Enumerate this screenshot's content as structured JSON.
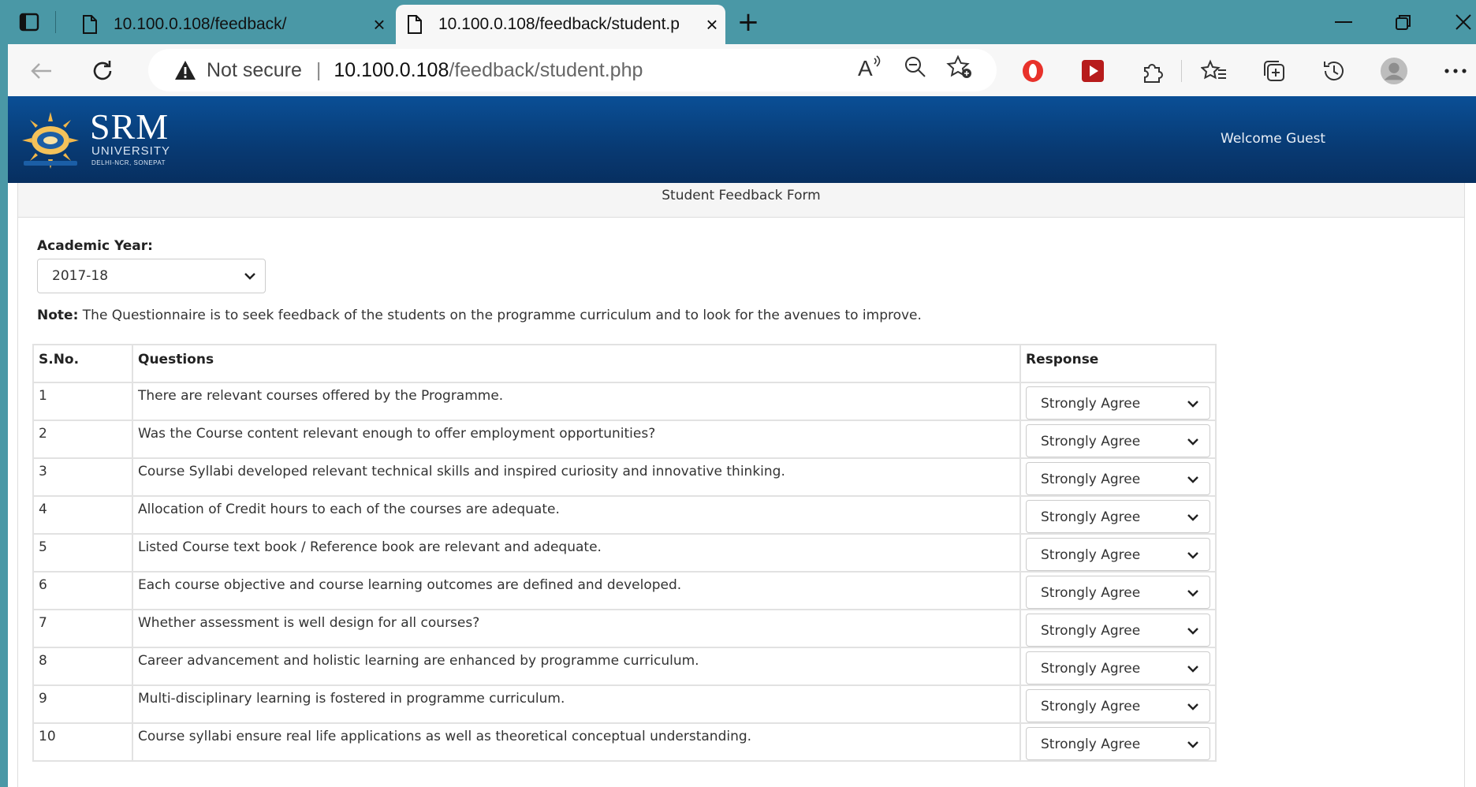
{
  "browser": {
    "tabs": [
      {
        "title": "10.100.0.108/feedback/",
        "active": false
      },
      {
        "title": "10.100.0.108/feedback/student.p",
        "active": true
      }
    ],
    "address": {
      "security_label": "Not secure",
      "host": "10.100.0.108",
      "path": "/feedback/student.php"
    },
    "icons": {
      "tab_actions": "tab-actions-icon",
      "new_tab": "plus-icon",
      "back": "back-arrow-icon",
      "refresh": "refresh-icon",
      "read_aloud": "read-aloud-icon",
      "zoom": "zoom-out-icon",
      "favorite": "add-favorite-icon",
      "opera": "opera-icon",
      "youtube": "youtube-icon",
      "extensions": "extensions-icon",
      "favorites": "favorites-icon",
      "collections": "collections-icon",
      "history": "history-icon",
      "profile": "profile-icon",
      "menu": "more-icon"
    }
  },
  "site": {
    "logo": {
      "name": "SRM",
      "line1": "UNIVERSITY",
      "line2": "DELHI-NCR, SONEPAT"
    },
    "welcome": "Welcome Guest"
  },
  "form": {
    "title": "Student Feedback Form",
    "academic_year_label": "Academic Year:",
    "academic_year_value": "2017-18",
    "note_label": "Note:",
    "note_text": " The Questionnaire is to seek feedback of the students on the programme curriculum and to look for the avenues to improve.",
    "columns": {
      "sno": "S.No.",
      "question": "Questions",
      "response": "Response"
    },
    "rows": [
      {
        "sno": "1",
        "question": "There are relevant courses offered by the Programme.",
        "response": "Strongly Agree"
      },
      {
        "sno": "2",
        "question": "Was the Course content relevant enough to offer employment opportunities?",
        "response": "Strongly Agree"
      },
      {
        "sno": "3",
        "question": "Course Syllabi developed relevant technical skills and inspired curiosity and innovative thinking.",
        "response": "Strongly Agree"
      },
      {
        "sno": "4",
        "question": "Allocation of Credit hours to each of the courses are adequate.",
        "response": "Strongly Agree"
      },
      {
        "sno": "5",
        "question": "Listed Course text book / Reference book are relevant and adequate.",
        "response": "Strongly Agree"
      },
      {
        "sno": "6",
        "question": "Each course objective and course learning outcomes are defined and developed.",
        "response": "Strongly Agree"
      },
      {
        "sno": "7",
        "question": "Whether assessment is well design for all courses?",
        "response": "Strongly Agree"
      },
      {
        "sno": "8",
        "question": "Career advancement and holistic learning are enhanced by programme curriculum.",
        "response": "Strongly Agree"
      },
      {
        "sno": "9",
        "question": "Multi-disciplinary learning is fostered in programme curriculum.",
        "response": "Strongly Agree"
      },
      {
        "sno": "10",
        "question": "Course syllabi ensure real life applications as well as theoretical conceptual understanding.",
        "response": "Strongly Agree"
      }
    ]
  },
  "colors": {
    "tabbar": "#4a98a6",
    "header": "#0a4f96",
    "accent_red": "#e8322b"
  }
}
